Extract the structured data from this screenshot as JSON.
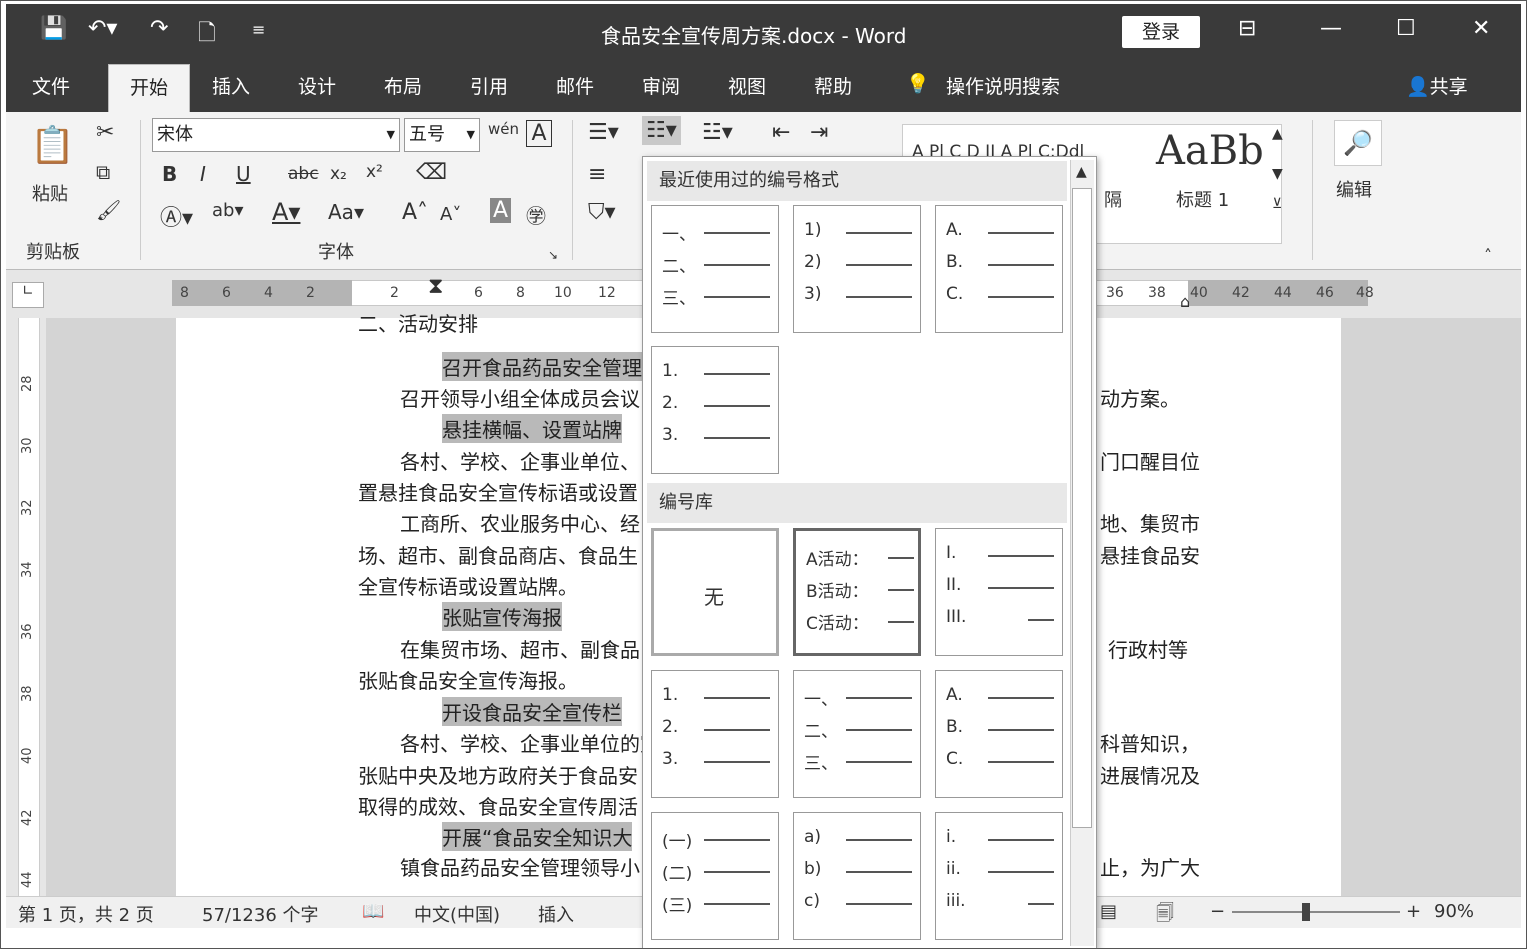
{
  "titlebar": {
    "doc_title": "食品安全宣传周方案.docx  -  Word",
    "login": "登录"
  },
  "tabs": [
    "文件",
    "开始",
    "插入",
    "设计",
    "布局",
    "引用",
    "邮件",
    "审阅",
    "视图",
    "帮助"
  ],
  "tell_me": "操作说明搜索",
  "share": "共享",
  "ribbon": {
    "paste": "粘贴",
    "clipboard": "剪贴板",
    "font_group": "字体",
    "font_name": "宋体",
    "font_size": "五号",
    "bold": "B",
    "italic": "I",
    "underline": "U",
    "strike": "abc",
    "sub": "x₂",
    "sup": "x²",
    "aa": "Aa",
    "edit": "编辑",
    "style_preview": "AaBb",
    "style_label": "标题 1",
    "style_partial": "隔",
    "style_top": "A Pl C D II  A Pl C:Ddl"
  },
  "ruler": {
    "left_ticks": [
      "8",
      "6",
      "4",
      "2"
    ],
    "right_ticks": [
      "2",
      "4",
      "6",
      "8",
      "10",
      "12"
    ],
    "far_ticks": [
      "36",
      "38",
      "40",
      "42",
      "44",
      "46",
      "48"
    ],
    "vticks": [
      "28",
      "30",
      "32",
      "34",
      "36",
      "38",
      "40",
      "42",
      "44"
    ]
  },
  "document": {
    "lines": [
      {
        "text": "二、活动安排",
        "hl": false
      },
      {
        "text": "召开食品药品安全管理",
        "hl": true
      },
      {
        "text": "召开领导小组全体成员会议",
        "hl": false
      },
      {
        "text": "悬挂横幅、设置站牌",
        "hl": true
      },
      {
        "text": "各村、学校、企事业单位、",
        "hl": false
      },
      {
        "text": "置悬挂食品安全宣传标语或设置",
        "hl": false
      },
      {
        "text": "工商所、农业服务中心、经",
        "hl": false
      },
      {
        "text": "场、超市、副食品商店、食品生",
        "hl": false
      },
      {
        "text": "全宣传标语或设置站牌。",
        "hl": false
      },
      {
        "text": "张贴宣传海报",
        "hl": true
      },
      {
        "text": "在集贸市场、超市、副食品",
        "hl": false
      },
      {
        "text": "张贴食品安全宣传海报。",
        "hl": false
      },
      {
        "text": "开设食品安全宣传栏",
        "hl": true
      },
      {
        "text": "各村、学校、企事业单位的宣",
        "hl": false
      },
      {
        "text": "张贴中央及地方政府关于食品安",
        "hl": false
      },
      {
        "text": "取得的成效、食品安全宣传周活",
        "hl": false
      },
      {
        "text": "开展“食品安全知识大",
        "hl": true
      },
      {
        "text": "镇食品药品安全管理领导小",
        "hl": false
      }
    ],
    "right_fragments": [
      "动方案。",
      "门口醒目位",
      "地、集贸市",
      "悬挂食品安",
      "行政村等",
      "科普知识，",
      "进展情况及",
      "止，为广大"
    ]
  },
  "dropdown": {
    "recent_title": "最近使用过的编号格式",
    "library_title": "编号库",
    "none": "无",
    "recent": [
      [
        "一、",
        "二、",
        "三、"
      ],
      [
        "1)",
        "2)",
        "3)"
      ],
      [
        "A.",
        "B.",
        "C."
      ],
      [
        "1.",
        "2.",
        "3."
      ]
    ],
    "library": [
      [
        "A活动：",
        "B活动：",
        "C活动："
      ],
      [
        "I.",
        "II.",
        "III."
      ],
      [
        "1.",
        "2.",
        "3."
      ],
      [
        "一、",
        "二、",
        "三、"
      ],
      [
        "A.",
        "B.",
        "C."
      ],
      [
        "(一)",
        "(二)",
        "(三)"
      ],
      [
        "a)",
        "b)",
        "c)"
      ],
      [
        "i.",
        "ii.",
        "iii."
      ]
    ]
  },
  "status": {
    "page": "第 1 页，共 2 页",
    "words": "57/1236 个字",
    "lang": "中文(中国)",
    "mode": "插入",
    "zoom": "90%"
  },
  "colors": {
    "titlebar": "#3a3a3a",
    "ribbon": "#f3f3f3",
    "highlight": "#b9b9b9"
  }
}
